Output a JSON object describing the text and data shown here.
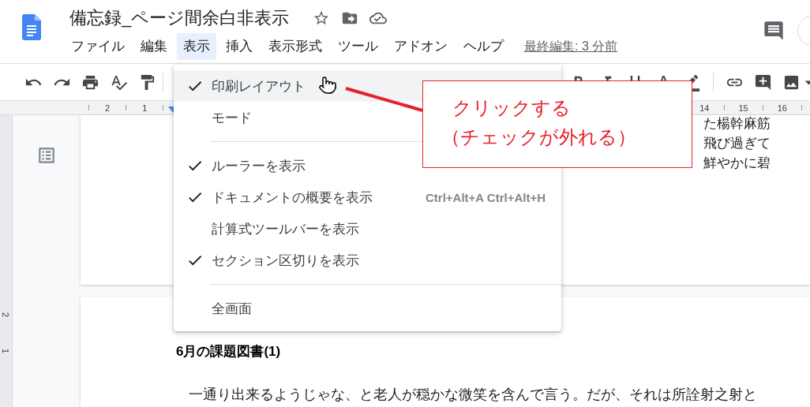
{
  "document": {
    "title": "備忘録_ページ間余白非表示",
    "last_edit": "最終編集: 3 分前"
  },
  "menu_bar": [
    {
      "label": "ファイル",
      "selected": false
    },
    {
      "label": "編集",
      "selected": false
    },
    {
      "label": "表示",
      "selected": true
    },
    {
      "label": "挿入",
      "selected": false
    },
    {
      "label": "表示形式",
      "selected": false
    },
    {
      "label": "ツール",
      "selected": false
    },
    {
      "label": "アドオン",
      "selected": false
    },
    {
      "label": "ヘルプ",
      "selected": false
    }
  ],
  "ruler": {
    "left_labels": [
      "2",
      "1"
    ],
    "right_labels": [
      "14",
      "15",
      "16"
    ]
  },
  "vertical_ruler": [
    "2",
    "1"
  ],
  "page_1": {
    "lines": [
      "た楊幹麻筋",
      "飛び過ぎて",
      "鮮やかに碧"
    ]
  },
  "page_2": {
    "heading": "6月の課題図書(1)",
    "paragraph": "一通り出来るようじゃな、と老人が穏かな微笑を含んで言う。だが、それは所詮射之射と"
  },
  "view_menu": [
    {
      "kind": "item",
      "label": "印刷レイアウト",
      "checked": true,
      "highlighted": true
    },
    {
      "kind": "item",
      "label": "モード",
      "checked": false,
      "highlighted": false
    },
    {
      "kind": "divider"
    },
    {
      "kind": "item",
      "label": "ルーラーを表示",
      "checked": true,
      "highlighted": false
    },
    {
      "kind": "item",
      "label": "ドキュメントの概要を表示",
      "checked": true,
      "highlighted": false,
      "shortcut": "Ctrl+Alt+A Ctrl+Alt+H"
    },
    {
      "kind": "item",
      "label": "計算式ツールバーを表示",
      "checked": false,
      "highlighted": false
    },
    {
      "kind": "item",
      "label": "セクション区切りを表示",
      "checked": true,
      "highlighted": false
    },
    {
      "kind": "divider"
    },
    {
      "kind": "item",
      "label": "全画面",
      "checked": false,
      "highlighted": false
    }
  ],
  "annotation": {
    "lines": [
      "クリックする",
      "（チェックが外れる）"
    ]
  }
}
